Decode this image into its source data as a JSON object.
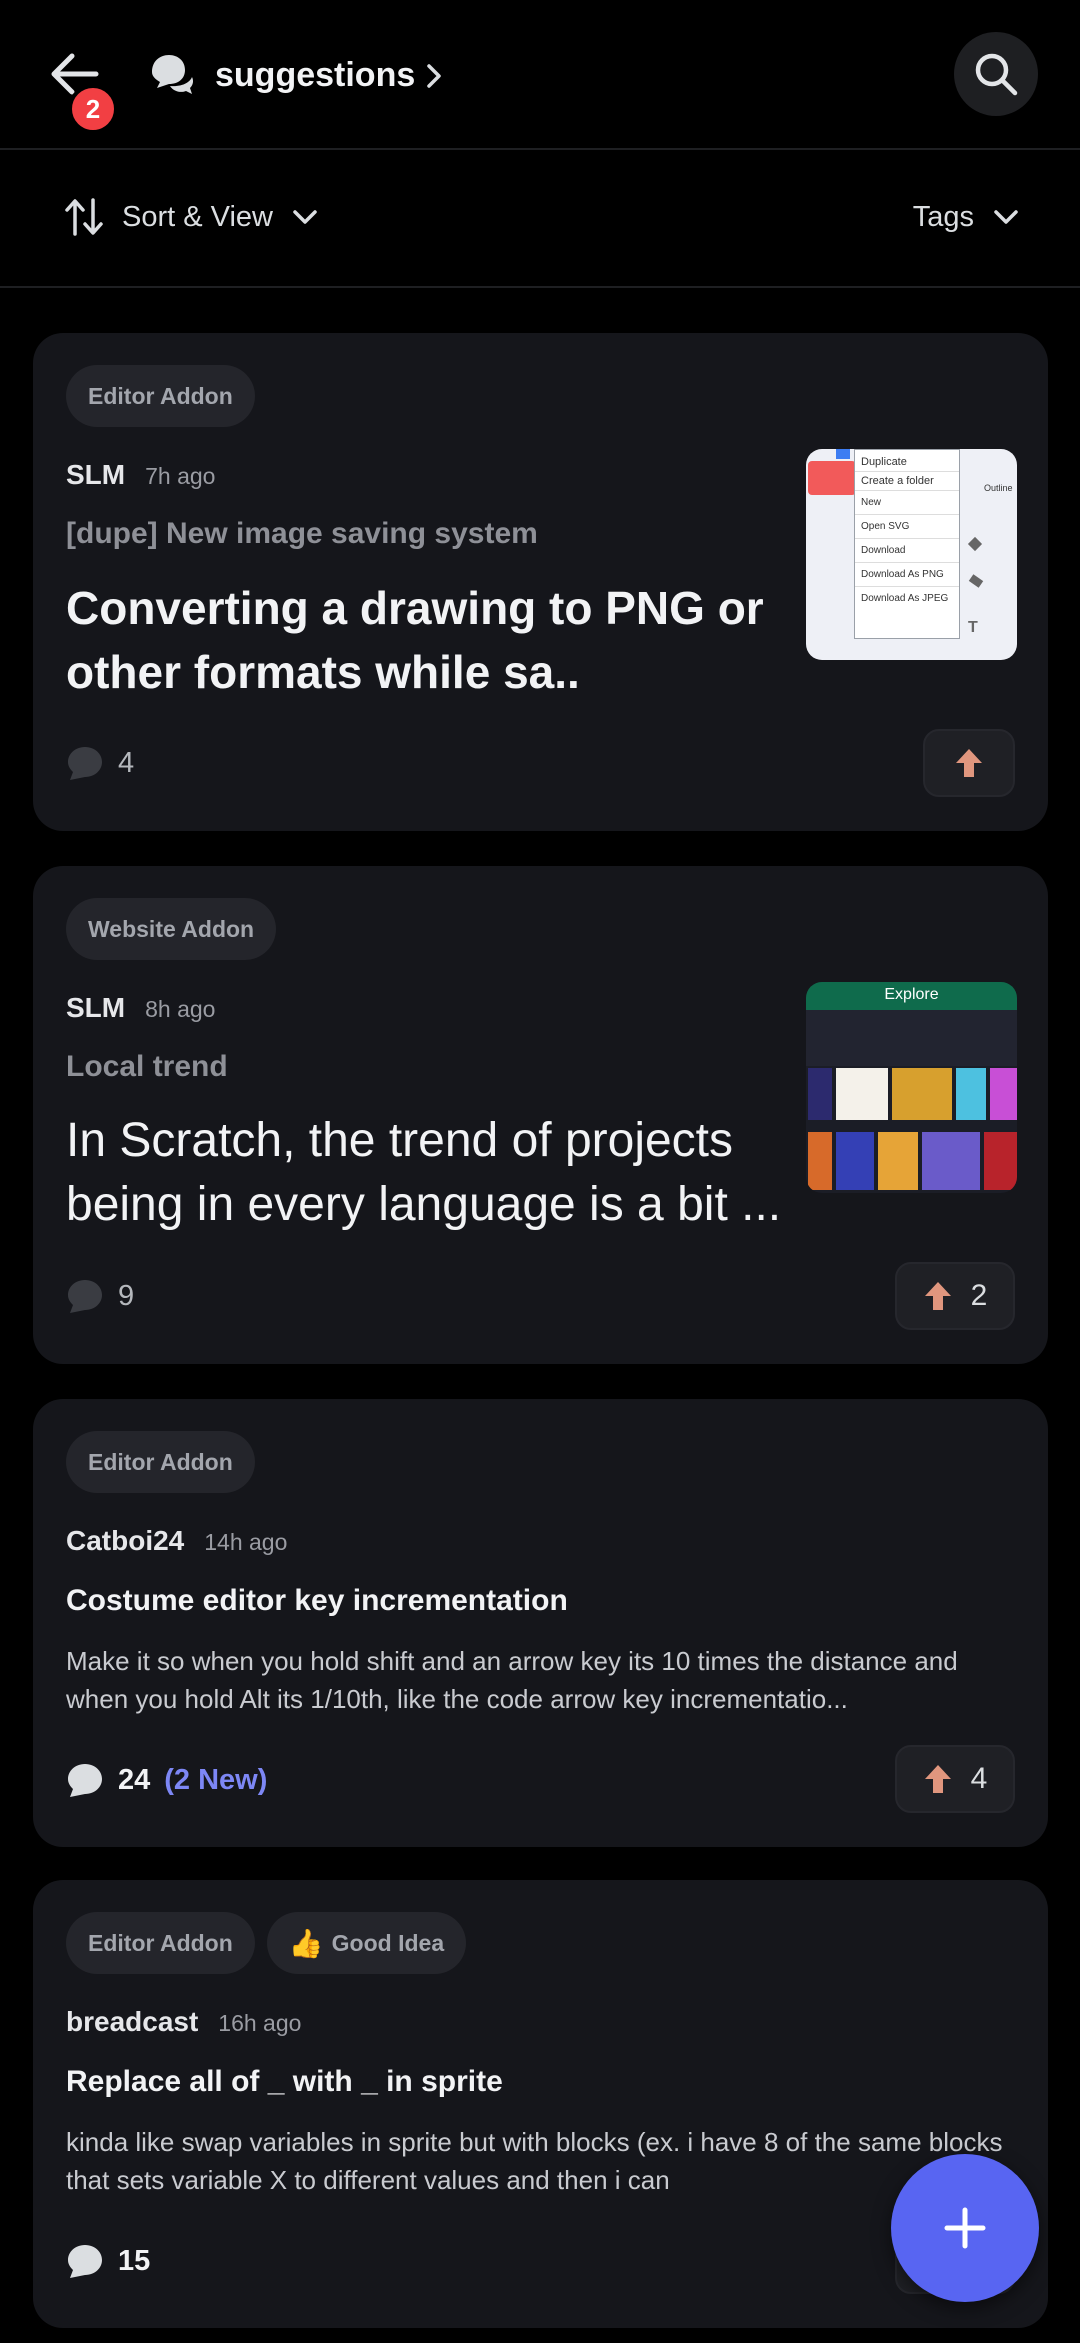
{
  "header": {
    "back_badge": "2",
    "channel_title": "suggestions",
    "icons": {
      "back": "arrow-left-icon",
      "forum": "forum-icon",
      "chevron": "chevron-right-icon",
      "search": "search-icon"
    }
  },
  "toolbar": {
    "sort_label": "Sort & View",
    "tags_label": "Tags"
  },
  "posts": [
    {
      "tags": [
        "Editor Addon"
      ],
      "author": "SLM",
      "time": "7h ago",
      "subtitle": "[dupe] New image saving system",
      "content": "Converting a drawing to PNG or other formats while sa..",
      "comments": "4",
      "votes": "",
      "thumbnail_menu": [
        "Duplicate",
        "Create a folder",
        "New",
        "Open SVG",
        "Download",
        "Download As PNG",
        "Download As JPEG"
      ],
      "thumbnail_side_label": "Outline"
    },
    {
      "tags": [
        "Website Addon"
      ],
      "author": "SLM",
      "time": "8h ago",
      "subtitle": "Local trend",
      "content": "In Scratch, the trend of projects being in every language is a bit ...",
      "comments": "9",
      "votes": "2",
      "thumbnail_header": "Explore"
    },
    {
      "tags": [
        "Editor Addon"
      ],
      "author": "Catboi24",
      "time": "14h ago",
      "title": "Costume editor key incrementation",
      "body": "Make it so when you hold shift and an arrow key its 10 times the distance and when you hold Alt its 1/10th, like the code arrow key incrementatio...",
      "comments": "24",
      "new_comments": "(2 New)",
      "votes": "4"
    },
    {
      "tags": [
        "Editor Addon",
        "Good Idea"
      ],
      "tag_emoji": "👍",
      "author": "breadcast",
      "time": "16h ago",
      "title": "Replace all of _ with _ in sprite",
      "body": "kinda like swap variables in sprite but with blocks  (ex. i have 8 of the same blocks that sets variable X to different values and then i can",
      "comments": "15"
    }
  ],
  "colors": {
    "accent": "#5865f2",
    "upvote": "#e0967e",
    "badge": "#f23f43",
    "card": "#15161b"
  }
}
